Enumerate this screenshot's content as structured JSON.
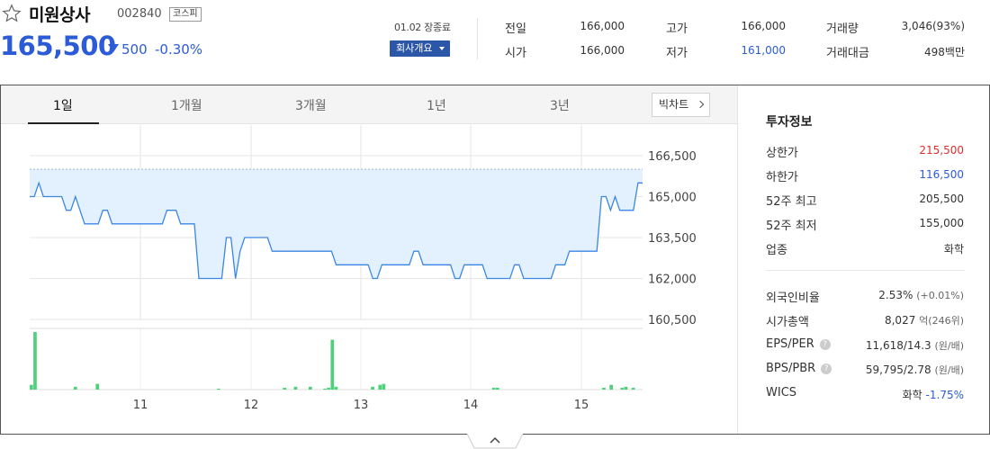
{
  "header": {
    "stock_name": "미원상사",
    "stock_code": "002840",
    "market": "코스피",
    "price": "165,500",
    "change": "500",
    "change_pct": "-0.30%",
    "close_time": "01.02 장종료",
    "profile_button": "회사개요"
  },
  "quote": {
    "prev_close_label": "전일",
    "prev_close": "166,000",
    "open_label": "시가",
    "open": "166,000",
    "high_label": "고가",
    "high": "166,000",
    "low_label": "저가",
    "low": "161,000",
    "volume_label": "거래량",
    "volume": "3,046(93%)",
    "amount_label": "거래대금",
    "amount": "498백만"
  },
  "tabs": [
    "1일",
    "1개월",
    "3개월",
    "1년",
    "3년"
  ],
  "bigchart_button": "빅차트",
  "chart_data": {
    "type": "line",
    "x_ticks": [
      "11",
      "12",
      "13",
      "14",
      "15"
    ],
    "y_ticks": [
      "166,500",
      "165,000",
      "163,500",
      "162,000",
      "160,500"
    ],
    "ylim": [
      160500,
      166500
    ],
    "prev_close": 166000,
    "price_series": [
      165000,
      165000,
      165500,
      165000,
      165000,
      165000,
      165000,
      165000,
      164500,
      164500,
      165000,
      164500,
      164000,
      164000,
      164000,
      164000,
      164500,
      164500,
      164000,
      164000,
      164000,
      164000,
      164000,
      164000,
      164000,
      164000,
      164000,
      164000,
      164000,
      164000,
      164500,
      164500,
      164500,
      164000,
      164000,
      164000,
      164000,
      162000,
      162000,
      162000,
      162000,
      162000,
      162000,
      163500,
      163500,
      162000,
      163000,
      163500,
      163500,
      163500,
      163500,
      163500,
      163500,
      163000,
      163000,
      163000,
      163000,
      163000,
      163000,
      163000,
      163000,
      163000,
      163000,
      163000,
      163000,
      163000,
      163000,
      162500,
      162500,
      162500,
      162500,
      162500,
      162500,
      162500,
      162500,
      162000,
      162000,
      162500,
      162500,
      162500,
      162500,
      162500,
      162500,
      162500,
      163000,
      163000,
      162500,
      162500,
      162500,
      162500,
      162500,
      162500,
      162500,
      162000,
      162000,
      162500,
      162500,
      162500,
      162500,
      162500,
      162000,
      162000,
      162000,
      162000,
      162000,
      162000,
      162500,
      162500,
      162000,
      162000,
      162000,
      162000,
      162000,
      162000,
      162000,
      162500,
      162500,
      162500,
      163000,
      163000,
      163000,
      163000,
      163000,
      163000,
      163000,
      165000,
      165000,
      164500,
      165000,
      164500,
      164500,
      164500,
      164500,
      165500,
      165500
    ],
    "volume_series": [
      5,
      60,
      0,
      0,
      0,
      0,
      0,
      0,
      0,
      0,
      0,
      0,
      3,
      0,
      0,
      0,
      0,
      0,
      6,
      0,
      0,
      0,
      0,
      0,
      0,
      0,
      0,
      0,
      0,
      0,
      0,
      0,
      0,
      0,
      0,
      0,
      0,
      0,
      0,
      0,
      0,
      0,
      0,
      0,
      0,
      0,
      0,
      0,
      0,
      0,
      0,
      1,
      0,
      0,
      0,
      0,
      0,
      0,
      0,
      0,
      0,
      0,
      0,
      0,
      0,
      0,
      0,
      0,
      0,
      2,
      0,
      0,
      3,
      0,
      0,
      0,
      3,
      0,
      0,
      0,
      1,
      2,
      52,
      3,
      0,
      0,
      0,
      0,
      0,
      0,
      0,
      0,
      0,
      3,
      0,
      5,
      6,
      0,
      0,
      0,
      0,
      0,
      0,
      0,
      0,
      0,
      0,
      0,
      0,
      0,
      0,
      0,
      0,
      0,
      0,
      0,
      0,
      0,
      0,
      0,
      0,
      0,
      0,
      0,
      0,
      0,
      2,
      2,
      0,
      0,
      0,
      0,
      0,
      0,
      0,
      0,
      0,
      0,
      0,
      0,
      0,
      0,
      0,
      0,
      0,
      0,
      0,
      0,
      0,
      0,
      0,
      0,
      0,
      0,
      0,
      0,
      2,
      0,
      5,
      0,
      0,
      2,
      3,
      0,
      2,
      0,
      0
    ]
  },
  "invest_info": {
    "title": "투자정보",
    "rows1": [
      {
        "label": "상한가",
        "value": "215,500"
      },
      {
        "label": "하한가",
        "value": "116,500"
      },
      {
        "label": "52주 최고",
        "value": "205,500"
      },
      {
        "label": "52주 최저",
        "value": "155,000"
      },
      {
        "label": "업종",
        "value": "화학"
      }
    ],
    "foreign_ratio_label": "외국인비율",
    "foreign_ratio": "2.53%",
    "foreign_ratio_change": "(+0.01%)",
    "market_cap_label": "시가총액",
    "market_cap": "8,027",
    "market_cap_unit": "억",
    "market_cap_rank": "(246위)",
    "eps_per_label": "EPS/PER",
    "eps_per": "11,618/14.3",
    "eps_per_unit": "(원/배)",
    "bps_pbr_label": "BPS/PBR",
    "bps_pbr": "59,795/2.78",
    "bps_pbr_unit": "(원/배)",
    "wics_label": "WICS",
    "wics": "화학",
    "wics_change": "-1.75%",
    "question_mark": "?"
  },
  "colors": {
    "up": "#e12d2d",
    "down": "#2b5bd7",
    "line": "#3b87e6",
    "fill": "#e3f0fd",
    "volume": "#4fd07b"
  }
}
